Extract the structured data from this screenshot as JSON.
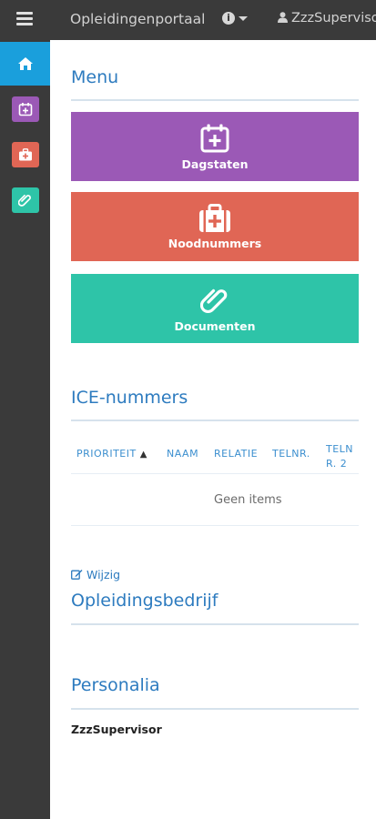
{
  "topbar": {
    "app_title": "Opleidingenportaal",
    "info_glyph": "i",
    "user_label": "ZzzSupervisor"
  },
  "sidebar": {
    "items": [
      {
        "icon": "home-icon",
        "color": "#1a9fdc",
        "active": true
      },
      {
        "icon": "calendar-plus-icon",
        "color": "#9b59b6"
      },
      {
        "icon": "medkit-icon",
        "color": "#e06655"
      },
      {
        "icon": "paperclip-icon",
        "color": "#2ec4a8"
      }
    ]
  },
  "menu": {
    "title": "Menu",
    "tiles": [
      {
        "label": "Dagstaten",
        "icon": "calendar-plus-icon",
        "color": "#9b59b6"
      },
      {
        "label": "Noodnummers",
        "icon": "medkit-icon",
        "color": "#e06655"
      },
      {
        "label": "Documenten",
        "icon": "paperclip-icon",
        "color": "#2ec4a8"
      }
    ]
  },
  "ice": {
    "title": "ICE-nummers",
    "columns": [
      "PRIORITEIT",
      "NAAM",
      "RELATIE",
      "TELNR.",
      "TELNR. 2"
    ],
    "empty_text": "Geen items"
  },
  "company": {
    "edit_label": "Wijzig",
    "title": "Opleidingsbedrijf"
  },
  "personal": {
    "title": "Personalia",
    "name": "ZzzSupervisor"
  }
}
